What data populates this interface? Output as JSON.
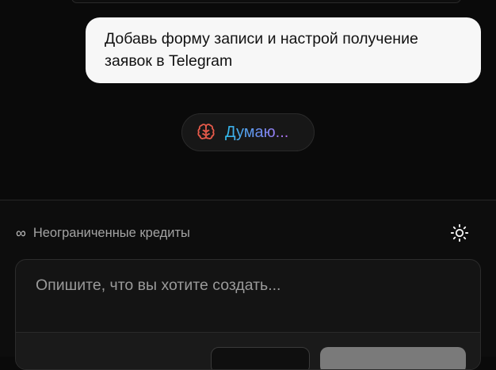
{
  "chat": {
    "user_message": "Добавь форму записи и настрой получение заявок в Telegram",
    "thinking_label": "Думаю..."
  },
  "footer": {
    "credits_icon": "∞",
    "credits_label": "Неограниченные кредиты",
    "theme_toggle_icon": "sun-icon"
  },
  "prompt": {
    "placeholder": "Опишите, что вы хотите создать...",
    "value": ""
  },
  "colors": {
    "background": "#0a0a0a",
    "bubble": "#f7f7f7",
    "thinking_gradient_start": "#2fb8e6",
    "thinking_gradient_end": "#b56ef0",
    "brain_icon": "#e65a4a"
  }
}
